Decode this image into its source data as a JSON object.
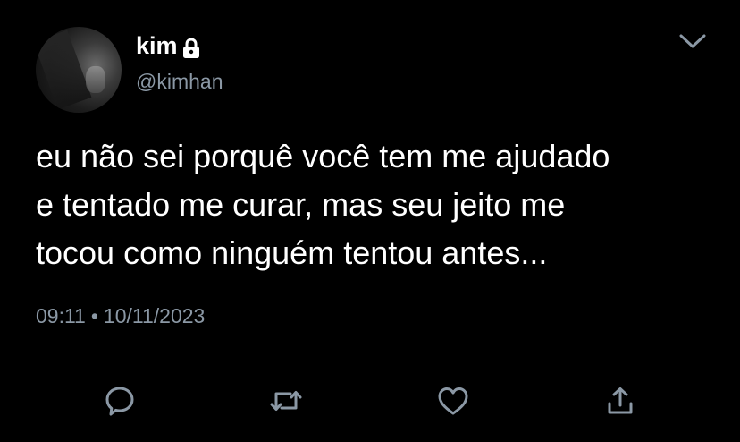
{
  "tweet": {
    "author": {
      "display_name": "kim",
      "handle": "@kimhan",
      "protected_icon": "lock-icon"
    },
    "menu_icon": "chevron-down-icon",
    "text": "eu não sei porquê você tem me ajudado\ne tentado me curar, mas seu jeito me\ntocou como ninguém tentou antes...",
    "time": "09:11",
    "separator": "•",
    "date": "10/11/2023",
    "actions": [
      {
        "name": "reply",
        "icon": "reply-icon"
      },
      {
        "name": "retweet",
        "icon": "retweet-icon"
      },
      {
        "name": "like",
        "icon": "heart-icon"
      },
      {
        "name": "share",
        "icon": "share-icon"
      }
    ]
  },
  "colors": {
    "background": "#000000",
    "primary_text": "#ffffff",
    "secondary_text": "#8b98a5",
    "divider": "#38444d",
    "icon": "#8b98a5"
  }
}
